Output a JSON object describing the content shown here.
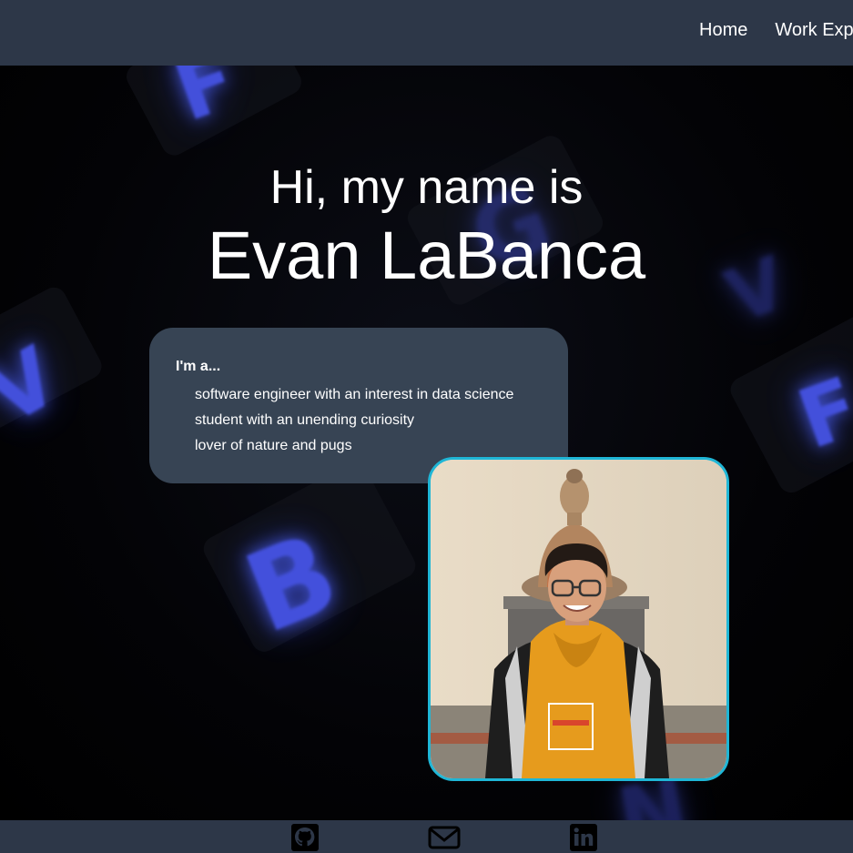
{
  "nav": {
    "links": [
      "Home",
      "Work Expe"
    ]
  },
  "hero": {
    "greeting": "Hi, my name is",
    "name": "Evan LaBanca"
  },
  "about": {
    "heading": "I'm a...",
    "items": [
      "software engineer with an interest in data science",
      "student with an unending curiosity",
      "lover of nature and pugs"
    ]
  },
  "photo": {
    "icon": "profile-photo"
  },
  "footer": {
    "icons": [
      "github-icon",
      "email-icon",
      "linkedin-icon"
    ]
  },
  "colors": {
    "nav_bg": "#2d3748",
    "card_bg": "#374454",
    "photo_border": "#1fb6d6",
    "key_glow": "#4d5cff"
  }
}
